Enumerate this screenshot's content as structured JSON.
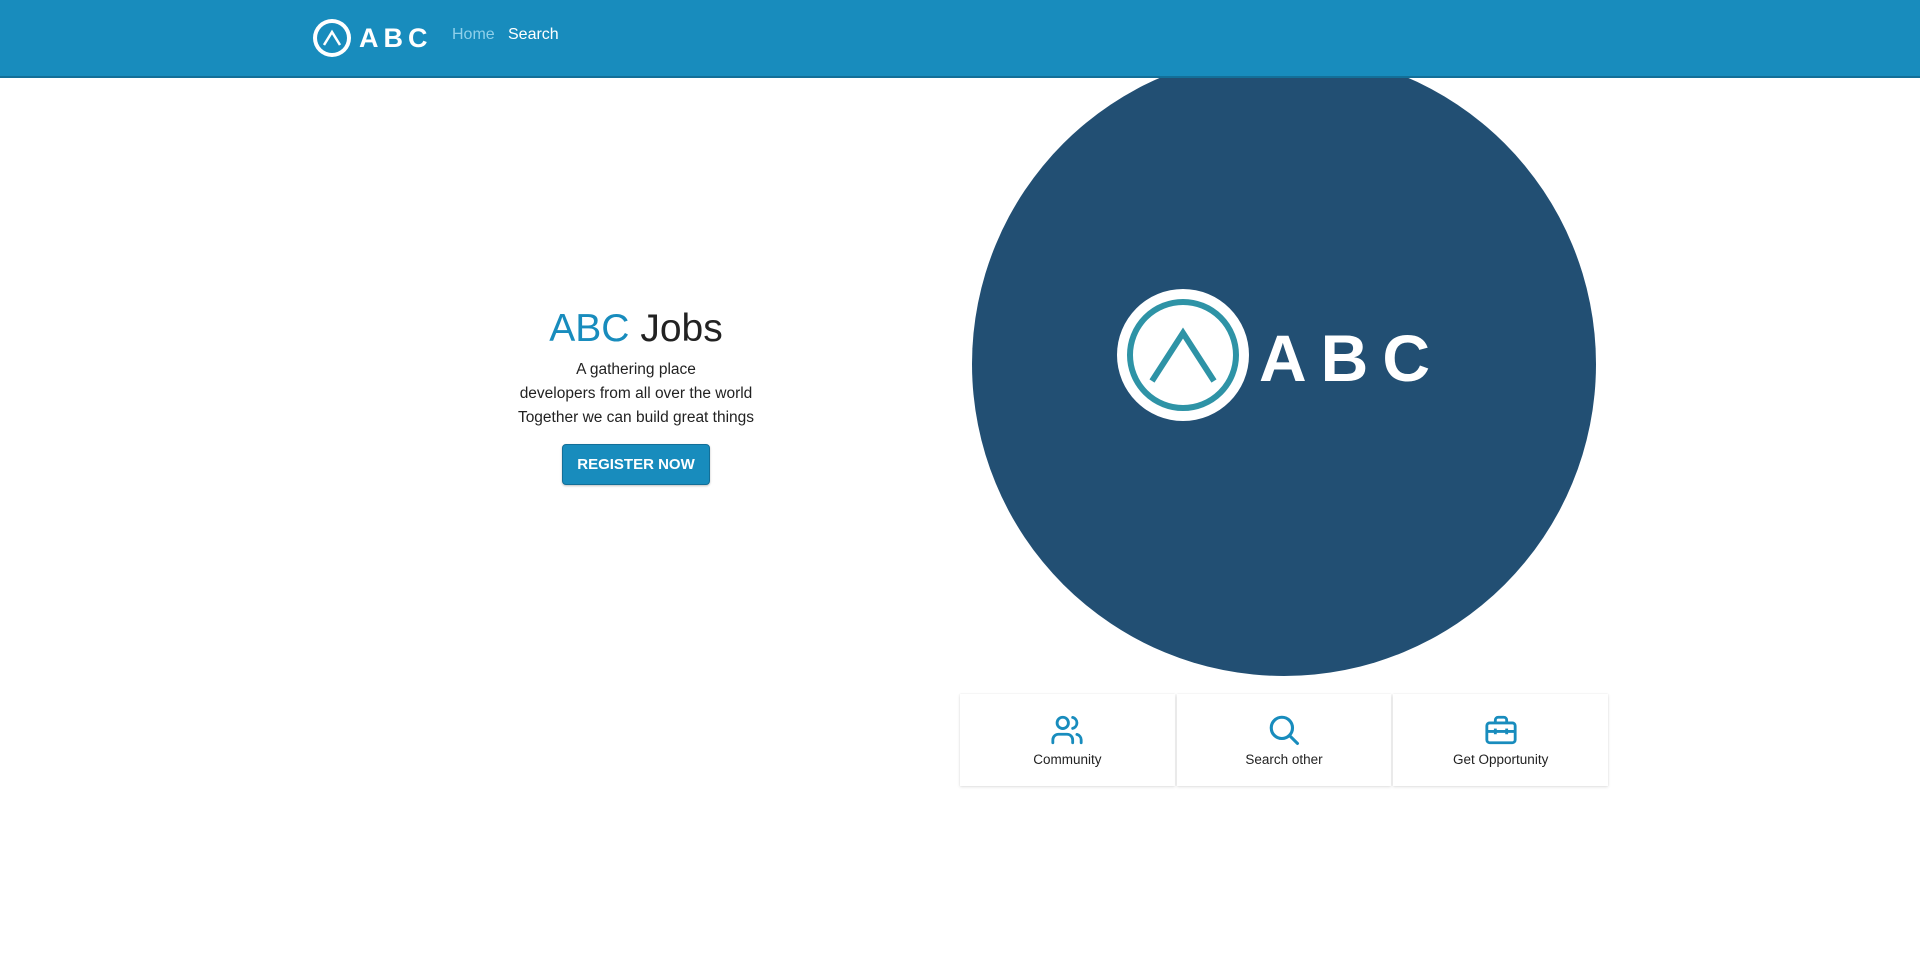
{
  "brand": {
    "name": "ABC"
  },
  "nav": {
    "home": "Home",
    "search": "Search"
  },
  "hero": {
    "title_accent": "ABC",
    "title_rest": "Jobs",
    "taglines": [
      "A gathering place",
      "developers from all over the world",
      "Together we can build great things"
    ],
    "register_label": "REGISTER NOW"
  },
  "showcase": {
    "logo_text": "ABC"
  },
  "features": [
    {
      "label": "Community",
      "icon": "users-icon"
    },
    {
      "label": "Search other",
      "icon": "search-icon"
    },
    {
      "label": "Get Opportunity",
      "icon": "briefcase-icon"
    }
  ],
  "colors": {
    "primary": "#188cbd",
    "circle": "#224f73",
    "logo_ring": "#2e93a6",
    "nav_active": "#8fd0ea"
  }
}
